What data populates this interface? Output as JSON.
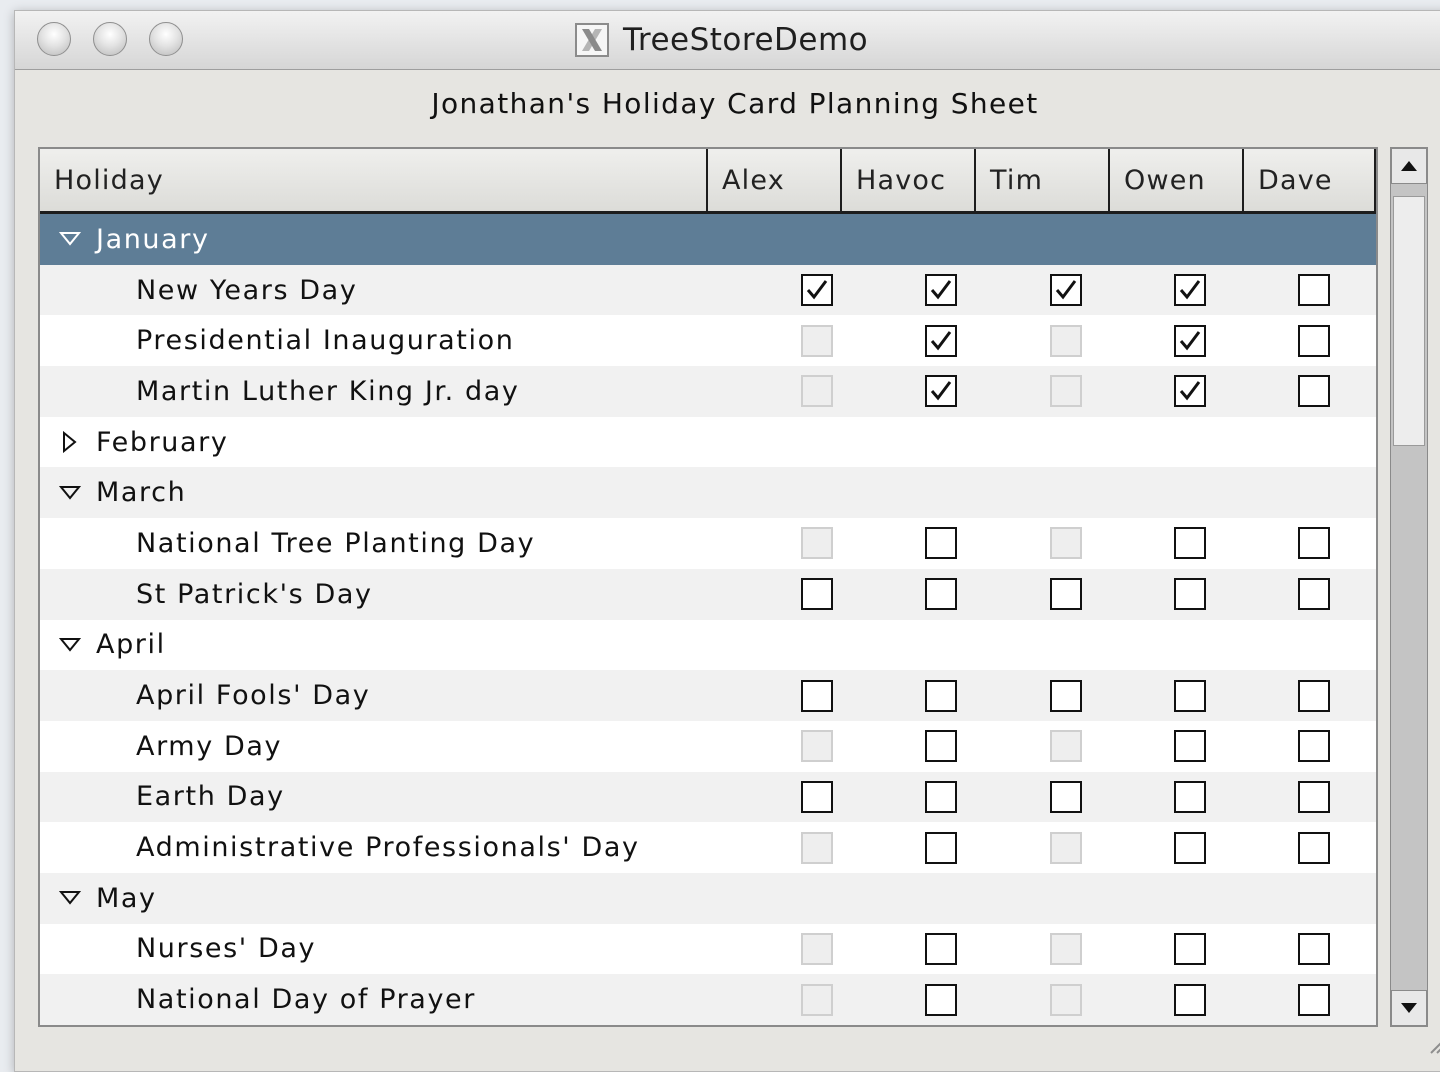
{
  "window": {
    "title": "TreeStoreDemo",
    "controls": [
      "close-button",
      "minimize-button",
      "zoom-button"
    ]
  },
  "sheet_title": "Jonathan's Holiday Card Planning Sheet",
  "columns": [
    "Holiday",
    "Alex",
    "Havoc",
    "Tim",
    "Owen",
    "Dave"
  ],
  "rows": [
    {
      "type": "parent",
      "label": "January",
      "expanded": true,
      "selected": true
    },
    {
      "type": "child",
      "label": "New Years Day",
      "checks": [
        "on",
        "on",
        "on",
        "on",
        "off"
      ]
    },
    {
      "type": "child",
      "label": "Presidential Inauguration",
      "checks": [
        "disabled",
        "on",
        "disabled",
        "on",
        "off"
      ]
    },
    {
      "type": "child",
      "label": "Martin Luther King Jr. day",
      "checks": [
        "disabled",
        "on",
        "disabled",
        "on",
        "off"
      ]
    },
    {
      "type": "parent",
      "label": "February",
      "expanded": false
    },
    {
      "type": "parent",
      "label": "March",
      "expanded": true
    },
    {
      "type": "child",
      "label": "National Tree Planting Day",
      "checks": [
        "disabled",
        "off",
        "disabled",
        "off",
        "off"
      ]
    },
    {
      "type": "child",
      "label": "St Patrick's Day",
      "checks": [
        "off",
        "off",
        "off",
        "off",
        "off"
      ]
    },
    {
      "type": "parent",
      "label": "April",
      "expanded": true
    },
    {
      "type": "child",
      "label": "April Fools' Day",
      "checks": [
        "off",
        "off",
        "off",
        "off",
        "off"
      ]
    },
    {
      "type": "child",
      "label": "Army Day",
      "checks": [
        "disabled",
        "off",
        "disabled",
        "off",
        "off"
      ]
    },
    {
      "type": "child",
      "label": "Earth Day",
      "checks": [
        "off",
        "off",
        "off",
        "off",
        "off"
      ]
    },
    {
      "type": "child",
      "label": "Administrative Professionals' Day",
      "checks": [
        "disabled",
        "off",
        "disabled",
        "off",
        "off"
      ]
    },
    {
      "type": "parent",
      "label": "May",
      "expanded": true
    },
    {
      "type": "child",
      "label": "Nurses' Day",
      "checks": [
        "disabled",
        "off",
        "disabled",
        "off",
        "off"
      ]
    },
    {
      "type": "child",
      "label": "National Day of Prayer",
      "checks": [
        "disabled",
        "off",
        "disabled",
        "off",
        "off"
      ]
    }
  ],
  "scrollbar": {
    "position": 0
  }
}
